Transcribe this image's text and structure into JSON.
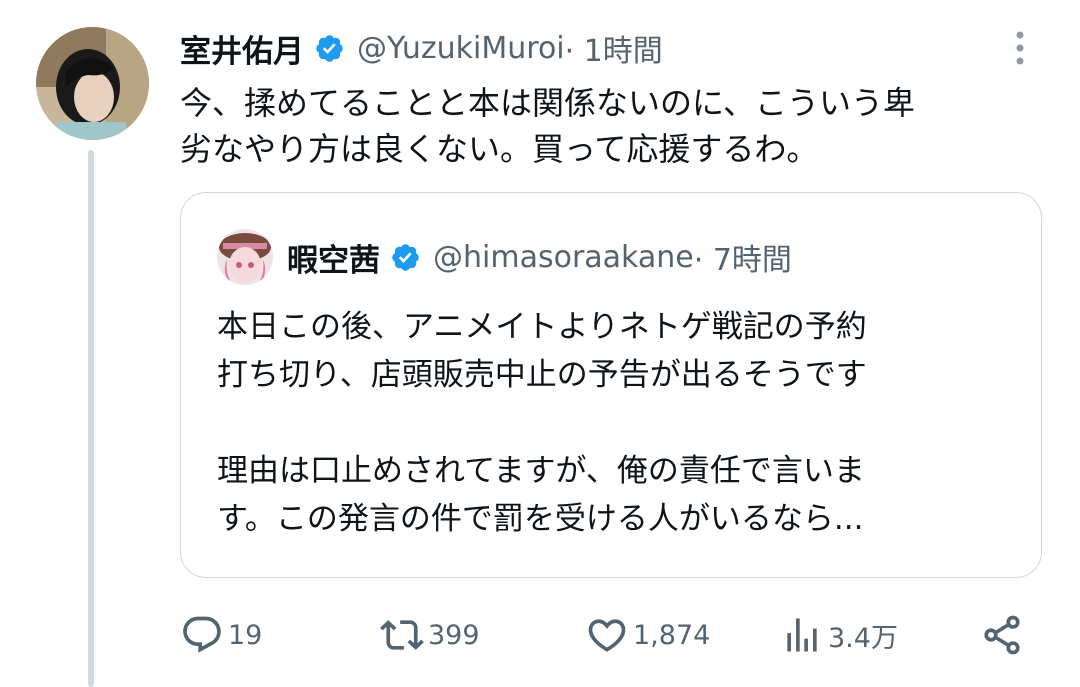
{
  "author": {
    "name": "室井佑月",
    "handle": "@YuzukiMuroi",
    "time": " · 1時間"
  },
  "tweet": {
    "text": "今、揉めてることと本は関係ないのに、こういう卑\n劣なやり方は良くない。買って応援するわ。"
  },
  "quote": {
    "name": "暇空茜",
    "handle": "@himasoraakane",
    "time": " · 7時間",
    "text": "本日この後、アニメイトよりネトゲ戦記の予約\n打ち切り、店頭販売中止の予告が出るそうです\n\n理由は口止めされてますが、俺の責任で言いま\nす。この発言の件で罰を受ける人がいるなら..."
  },
  "actions": {
    "replies": "19",
    "reposts": "399",
    "likes": "1,874",
    "views": "3.4万"
  },
  "colors": {
    "verified": "#1d9bf0",
    "secondary_text": "#536471",
    "border": "#cfd9de",
    "text": "#0f1419"
  }
}
